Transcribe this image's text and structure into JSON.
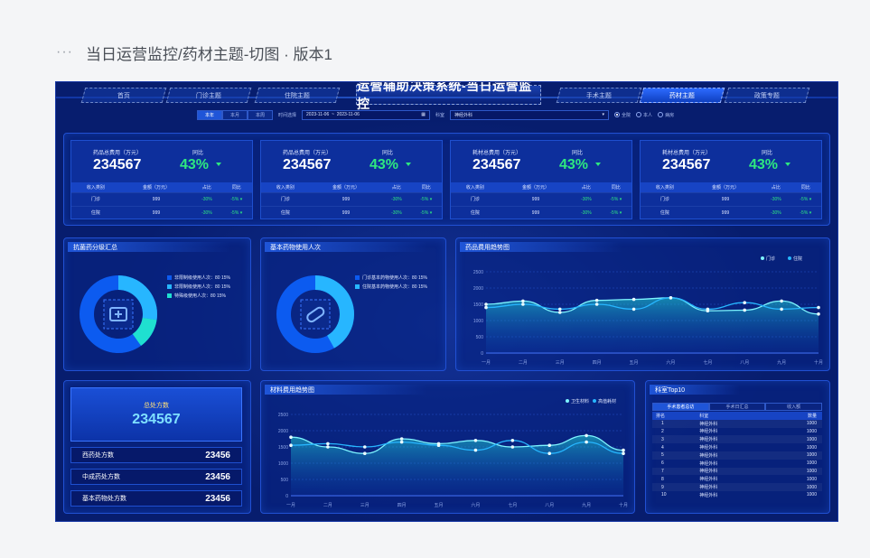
{
  "page": {
    "title": "当日运营监控/药材主题-切图 · 版本1"
  },
  "dashboard": {
    "title": "运营辅助决策系统-当日运营监控",
    "nav_left": [
      "首页",
      "门诊主题",
      "住院主题"
    ],
    "nav_right": [
      "手术主题",
      "药材主题",
      "政策专题"
    ],
    "filter": {
      "period_tabs": [
        "本年",
        "本月",
        "本周"
      ],
      "date_label": "时间选择",
      "date_from": "2023-11-06",
      "date_to": "2023-11-06",
      "dept_label": "科室",
      "dept_value": "神经外科",
      "radios": [
        "全院",
        "本人",
        "病房"
      ]
    },
    "cards": [
      {
        "label": "药品总费用（万元）",
        "value": "234567",
        "yoy_label": "同比",
        "yoy": "43%"
      },
      {
        "label": "药品总费用（万元）",
        "value": "234567",
        "yoy_label": "同比",
        "yoy": "43%"
      },
      {
        "label": "耗材总费用（万元）",
        "value": "234567",
        "yoy_label": "同比",
        "yoy": "43%"
      },
      {
        "label": "耗材总费用（万元）",
        "value": "234567",
        "yoy_label": "同比",
        "yoy": "43%"
      }
    ],
    "card_table": {
      "headers": [
        "收入类别",
        "金额（万元）",
        "占比",
        "同比"
      ],
      "rows": [
        [
          "门诊",
          "999",
          "-30%",
          "-5%"
        ],
        [
          "住院",
          "999",
          "-30%",
          "-5%"
        ]
      ]
    },
    "antibiotic": {
      "title": "抗菌药分级汇总",
      "legend": [
        "非限制级使用人次：80 15%",
        "非限制级使用人次：80 15%",
        "特殊级使用人次：80 15%"
      ]
    },
    "basic_drug": {
      "title": "基本药物使用人次",
      "legend": [
        "门诊基本药物使用人次：80 15%",
        "住院基本药物使用人次：80 15%"
      ]
    },
    "summary": {
      "total_label": "总处方数",
      "total_value": "234567",
      "rows": [
        {
          "label": "西药处方数",
          "value": "23456"
        },
        {
          "label": "中成药处方数",
          "value": "23456"
        },
        {
          "label": "基本药物处方数",
          "value": "23456"
        }
      ]
    },
    "top10": {
      "title": "科室Top10",
      "tabs": [
        "手术患者总访",
        "手术日汇总",
        "收入额"
      ],
      "headers": [
        "排名",
        "科室",
        "数量"
      ],
      "rows": [
        [
          "1",
          "神经外科",
          "1000"
        ],
        [
          "2",
          "神经外科",
          "1000"
        ],
        [
          "3",
          "神经外科",
          "1000"
        ],
        [
          "4",
          "神经外科",
          "1000"
        ],
        [
          "5",
          "神经外科",
          "1000"
        ],
        [
          "6",
          "神经外科",
          "1000"
        ],
        [
          "7",
          "神经外科",
          "1000"
        ],
        [
          "8",
          "神经外科",
          "1000"
        ],
        [
          "9",
          "神经外科",
          "1000"
        ],
        [
          "10",
          "神经外科",
          "1000"
        ]
      ]
    }
  },
  "chart_data": [
    {
      "type": "area",
      "title": "药品费用趋势图",
      "categories": [
        "一月",
        "二月",
        "三月",
        "四月",
        "五月",
        "六月",
        "七月",
        "八月",
        "九月",
        "十月"
      ],
      "ylim": [
        0,
        2500
      ],
      "yticks": [
        "0",
        "500",
        "1000",
        "1500",
        "2000",
        "2500"
      ],
      "series": [
        {
          "name": "门诊",
          "values": [
            1500,
            1600,
            1250,
            1620,
            1650,
            1700,
            1300,
            1320,
            1600,
            1200
          ]
        },
        {
          "name": "住院",
          "values": [
            1400,
            1500,
            1350,
            1500,
            1350,
            1700,
            1350,
            1550,
            1350,
            1400
          ]
        }
      ]
    },
    {
      "type": "area",
      "title": "材料费用趋势图",
      "categories": [
        "一月",
        "二月",
        "三月",
        "四月",
        "五月",
        "六月",
        "七月",
        "八月",
        "九月",
        "十月"
      ],
      "ylim": [
        0,
        2500
      ],
      "yticks": [
        "0",
        "500",
        "1000",
        "1500",
        "2000",
        "2500"
      ],
      "series": [
        {
          "name": "卫生材料",
          "values": [
            1800,
            1500,
            1300,
            1750,
            1600,
            1700,
            1500,
            1550,
            1850,
            1400
          ]
        },
        {
          "name": "高值耗材",
          "values": [
            1550,
            1600,
            1500,
            1650,
            1550,
            1400,
            1700,
            1300,
            1650,
            1300
          ]
        }
      ]
    }
  ]
}
